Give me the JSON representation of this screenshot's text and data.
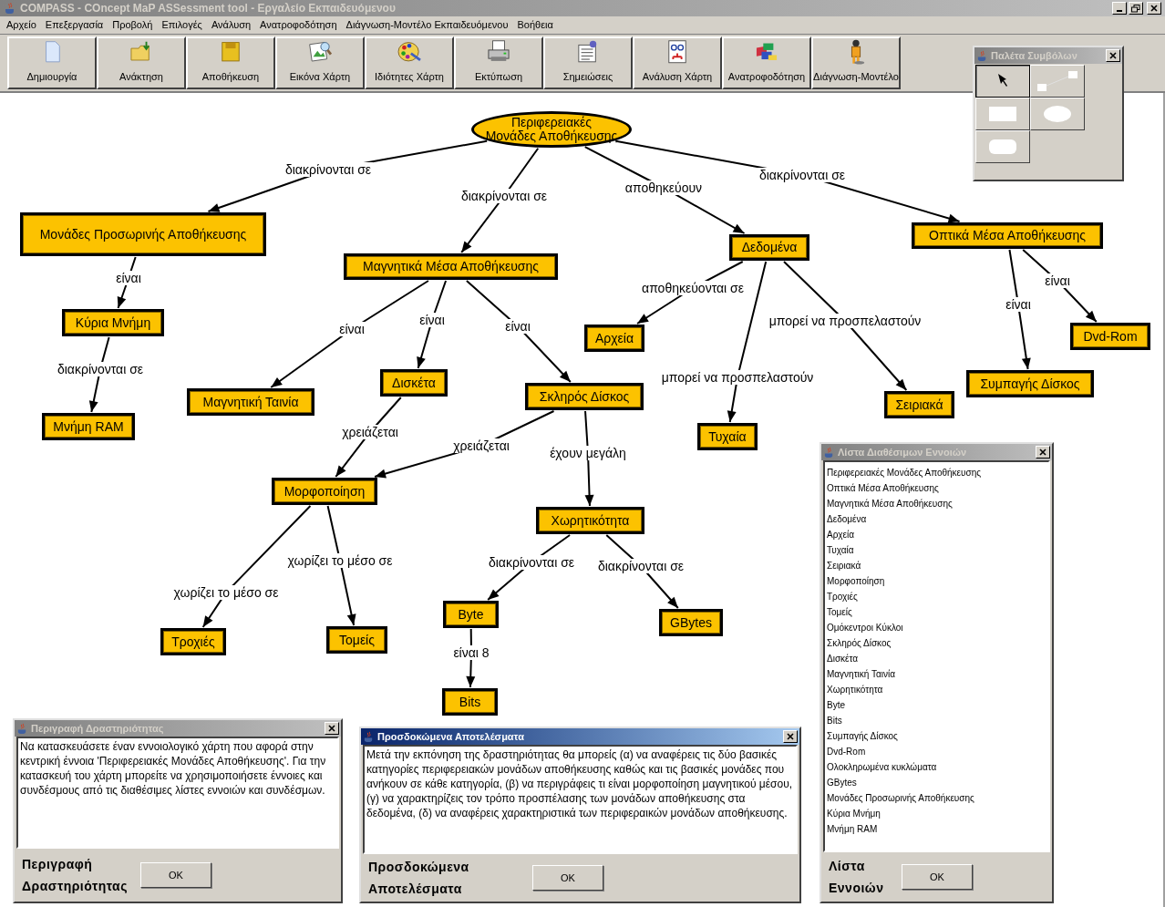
{
  "window": {
    "title": "COMPASS - COncept MaP ASSessment tool - Εργαλείο Εκπαιδευόμενου"
  },
  "menu": [
    "Αρχείο",
    "Επεξεργασία",
    "Προβολή",
    "Επιλογές",
    "Ανάλυση",
    "Ανατροφοδότηση",
    "Διάγνωση-Μοντέλο Εκπαιδευόμενου",
    "Βοήθεια"
  ],
  "toolbar": [
    "Δημιουργία",
    "Ανάκτηση",
    "Αποθήκευση",
    "Εικόνα Χάρτη",
    "Ιδιότητες Χάρτη",
    "Εκτύπωση",
    "Σημειώσεις",
    "Ανάλυση Χάρτη",
    "Ανατροφοδότηση",
    "Διάγνωση-Μοντέλο"
  ],
  "concept_map": {
    "nodes": [
      {
        "label": "Περιφερειακές Μονάδες Αποθήκευσης",
        "kind": "ellipse"
      },
      {
        "label": "Μονάδες Προσωρινής Αποθήκευσης",
        "kind": "rect"
      },
      {
        "label": "Οπτικά Μέσα Αποθήκευσης",
        "kind": "rect"
      },
      {
        "label": "Δεδομένα",
        "kind": "rect"
      },
      {
        "label": "Μαγνητικά Μέσα Αποθήκευσης",
        "kind": "rect"
      },
      {
        "label": "Κύρια Μνήμη",
        "kind": "rect"
      },
      {
        "label": "Dvd-Rom",
        "kind": "rect"
      },
      {
        "label": "Αρχεία",
        "kind": "rect"
      },
      {
        "label": "Δισκέτα",
        "kind": "rect"
      },
      {
        "label": "Συμπαγής Δίσκος",
        "kind": "rect"
      },
      {
        "label": "Σκληρός Δίσκος",
        "kind": "rect"
      },
      {
        "label": "Μαγνητική Ταινία",
        "kind": "rect"
      },
      {
        "label": "Σειριακά",
        "kind": "rect"
      },
      {
        "label": "Μνήμη RAM",
        "kind": "rect"
      },
      {
        "label": "Τυχαία",
        "kind": "rect"
      },
      {
        "label": "Μορφοποίηση",
        "kind": "rect"
      },
      {
        "label": "Χωρητικότητα",
        "kind": "rect"
      },
      {
        "label": "Byte",
        "kind": "rect"
      },
      {
        "label": "GBytes",
        "kind": "rect"
      },
      {
        "label": "Τροχιές",
        "kind": "rect"
      },
      {
        "label": "Τομείς",
        "kind": "rect"
      },
      {
        "label": "Bits",
        "kind": "rect"
      }
    ],
    "link_labels": [
      "διακρίνονται σε",
      "διακρίνονται σε",
      "αποθηκεύουν",
      "διακρίνονται σε",
      "είναι",
      "αποθηκεύονται σε",
      "είναι",
      "είναι",
      "είναι",
      "είναι",
      "είναι",
      "μπορεί να προσπελαστούν",
      "διακρίνονται σε",
      "μπορεί να προσπελαστούν",
      "χρειάζεται",
      "χρειάζεται",
      "έχουν μεγάλη",
      "χωρίζει το μέσο σε",
      "διακρίνονται σε",
      "διακρίνονται σε",
      "χωρίζει το μέσο σε",
      "είναι 8"
    ]
  },
  "palette": {
    "title": "Παλέτα Συμβόλων",
    "active": false,
    "tools": [
      {
        "selected": true
      },
      {
        "selected": false
      },
      {
        "selected": false
      },
      {
        "selected": false
      },
      {
        "selected": false
      }
    ]
  },
  "description_window": {
    "title": "Περιγραφή Δραστηριότητας",
    "active": false,
    "text": "Να κατασκευάσετε έναν εννοιολογικό χάρτη που αφορά στην κεντρική έννοια 'Περιφερειακές Μονάδες Αποθήκευσης'. Για την κατασκευή του χάρτη μπορείτε να χρησιμοποιήσετε έννοιες και συνδέσμους από τις διαθέσιμες λίστες εννοιών και συνδέσμων.",
    "caption": "Περιγραφή Δραστηριότητας",
    "button": "OK"
  },
  "expected_window": {
    "title": "Προσδοκώμενα Αποτελέσματα",
    "active": true,
    "text": "Μετά την εκπόνηση της δραστηριότητας θα μπορείς (α) να αναφέρεις τις δύο βασικές κατηγορίες περιφερειακών μονάδων αποθήκευσης καθώς και τις βασικές μονάδες που ανήκουν σε κάθε κατηγορία, (β) να περιγράφεις τι είναι μορφοποίηση μαγνητικού μέσου, (γ) να χαρακτηρίζεις τον τρόπο προσπέλασης των μονάδων αποθήκευσης στα δεδομένα, (δ) να αναφέρεις χαρακτηριστικά των περιφεραικών μονάδων αποθήκευσης.",
    "caption": "Προσδοκώμενα Αποτελέσματα",
    "button": "OK"
  },
  "concepts_window": {
    "title": "Λίστα Διαθέσιμων Εννοιών",
    "active": false,
    "items": [
      "Περιφερειακές Μονάδες Αποθήκευσης",
      "Οπτικά Μέσα Αποθήκευσης",
      "Μαγνητικά Μέσα Αποθήκευσης",
      "Δεδομένα",
      "Αρχεία",
      "Τυχαία",
      "Σειριακά",
      "Μορφοποίηση",
      "Τροχιές",
      "Τομείς",
      "Ομόκεντροι Κύκλοι",
      "Σκληρός Δίσκος",
      "Δισκέτα",
      "Μαγνητική Ταινία",
      "Χωρητικότητα",
      "Byte",
      "Bits",
      "Συμπαγής Δίσκος",
      "Dvd-Rom",
      "Ολοκληρωμένα κυκλώματα",
      "GBytes",
      "Μονάδες Προσωρινής Αποθήκευσης",
      "Κύρια Μνήμη",
      "Μνήμη RAM"
    ],
    "caption": "Λίστα Εννοιών",
    "button": "OK"
  }
}
